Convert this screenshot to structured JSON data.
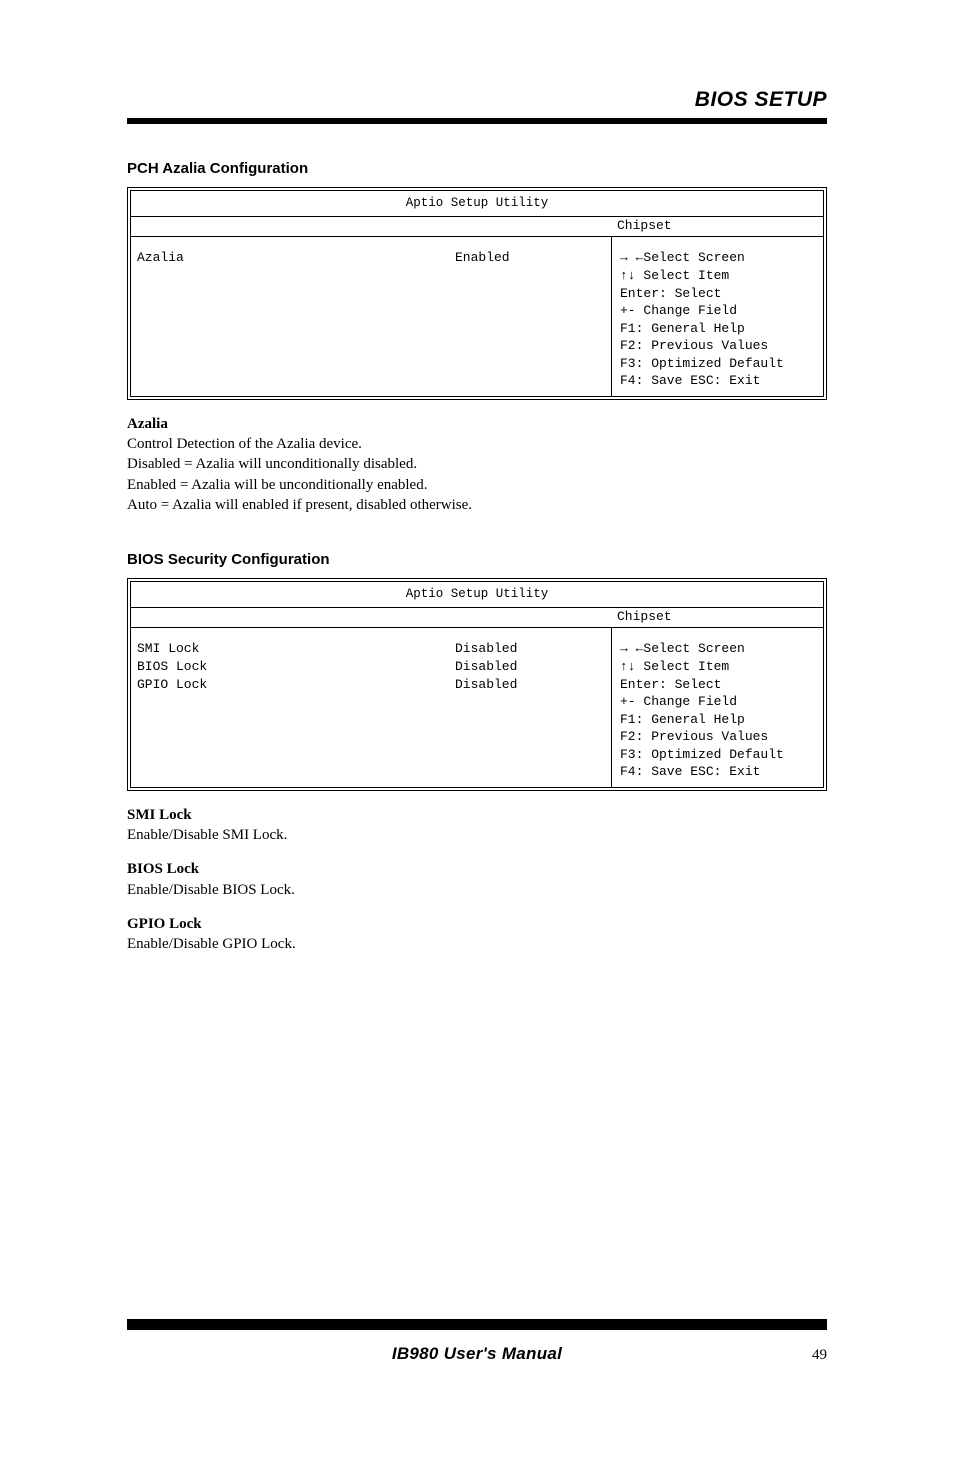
{
  "header": {
    "title": "BIOS SETUP"
  },
  "section1": {
    "title": "PCH Azalia Configuration",
    "bios_head": "Aptio Setup Utility",
    "sub_label": "Chipset",
    "left_label": "Azalia",
    "left_value": "Enabled",
    "hints": {
      "l1": "→ ←Select Screen",
      "l2": "↑↓ Select Item",
      "l3": "Enter: Select",
      "l4": "+-  Change Field",
      "l5": "F1: General Help",
      "l6": "F2: Previous Values",
      "l7": "F3: Optimized Default",
      "l8": "F4: Save  ESC: Exit"
    },
    "desc_h": "Azalia",
    "desc_p1": "Control Detection of the Azalia device.",
    "desc_p2": "Disabled = Azalia will unconditionally disabled.",
    "desc_p3": "Enabled = Azalia will be unconditionally enabled.",
    "desc_p4": "Auto = Azalia will enabled if present, disabled otherwise."
  },
  "section2": {
    "title": "BIOS Security Configuration",
    "bios_head": "Aptio Setup Utility",
    "sub_label": "Chipset",
    "leftrow1_label": "SMI Lock",
    "leftrow1_value": "Disabled",
    "leftrow2_label": "BIOS Lock",
    "leftrow2_value": "Disabled",
    "leftrow3_label": "GPIO Lock",
    "leftrow3_value": "Disabled",
    "hints": {
      "l1": "→ ←Select Screen",
      "l2": "↑↓ Select Item",
      "l3": "Enter: Select",
      "l4": "+-  Change Field",
      "l5": "F1: General Help",
      "l6": "F2: Previous Values",
      "l7": "F3: Optimized Default",
      "l8": "F4: Save  ESC: Exit"
    },
    "d1_h": "SMI Lock",
    "d1_p": "Enable/Disable SMI Lock.",
    "d2_h": "BIOS Lock",
    "d2_p": "Enable/Disable BIOS Lock.",
    "d3_h": "GPIO Lock",
    "d3_p": "Enable/Disable GPIO Lock."
  },
  "footer": {
    "title": "IB980 User's Manual",
    "page": "49"
  }
}
